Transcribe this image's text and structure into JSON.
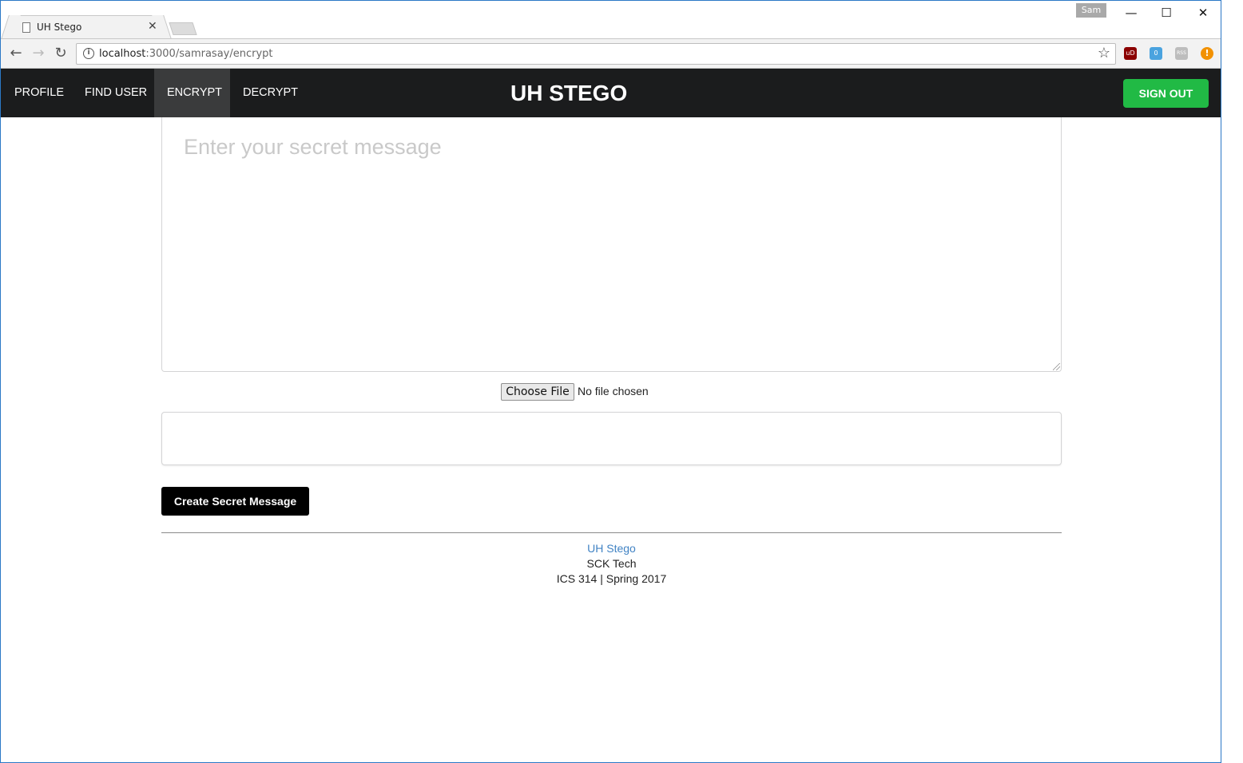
{
  "browser": {
    "tab_title": "UH Stego",
    "profile_name": "Sam",
    "url_host": "localhost",
    "url_path": ":3000/samrasay/encrypt",
    "window_controls": {
      "minimize": "—",
      "maximize": "☐",
      "close": "✕"
    },
    "extensions": [
      {
        "name": "ublock-icon",
        "color": "#8b0000",
        "label": "uD"
      },
      {
        "name": "ghostery-icon",
        "color": "#4aa3df",
        "label": "0"
      },
      {
        "name": "rss-icon",
        "color": "#bdbdbd",
        "label": "RSS"
      },
      {
        "name": "alert-extension-icon",
        "color": "#f29100",
        "label": "!"
      }
    ]
  },
  "nav": {
    "items": [
      {
        "label": "PROFILE",
        "active": false
      },
      {
        "label": "FIND USER",
        "active": false
      },
      {
        "label": "ENCRYPT",
        "active": true
      },
      {
        "label": "DECRYPT",
        "active": false
      }
    ],
    "brand": "UH STEGO",
    "signout_label": "SIGN OUT",
    "signout_color": "#21ba45"
  },
  "form": {
    "message_placeholder": "Enter your secret message",
    "message_value": "",
    "file_button_label": "Choose File",
    "file_status": "No file chosen",
    "output_value": "",
    "submit_label": "Create Secret Message"
  },
  "footer": {
    "link": "UH Stego",
    "company": "SCK Tech",
    "course": "ICS 314 | Spring 2017"
  }
}
